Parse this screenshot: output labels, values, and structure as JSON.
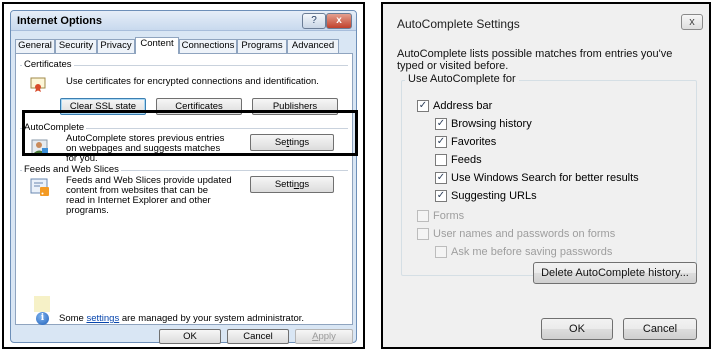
{
  "left_dialog": {
    "title": "Internet Options",
    "help_glyph": "?",
    "close_glyph": "x",
    "tabs": [
      "General",
      "Security",
      "Privacy",
      "Content",
      "Connections",
      "Programs",
      "Advanced"
    ],
    "active_tab": "Content",
    "certificates": {
      "label": "Certificates",
      "description": "Use certificates for encrypted connections and identification.",
      "clear_ssl_pre": "Clear ",
      "clear_ssl_u": "S",
      "clear_ssl_post": "SL state",
      "certificates_u": "C",
      "certificates_post": "ertificates",
      "publishers_pre": "Pu",
      "publishers_u": "b",
      "publishers_post": "lishers"
    },
    "autocomplete": {
      "label": "AutoComplete",
      "description_lines": [
        "AutoComplete stores previous entries",
        "on webpages and suggests matches",
        "for you."
      ],
      "settings_pre": "Se",
      "settings_u": "t",
      "settings_post": "tings"
    },
    "feeds": {
      "label": "Feeds and Web Slices",
      "description_lines": [
        "Feeds and Web Slices provide updated",
        "content from websites that can be",
        "read in Internet Explorer and other",
        "programs."
      ],
      "settings_pre": "Setti",
      "settings_u": "n",
      "settings_post": "gs"
    },
    "admin_note_pre": "Some ",
    "admin_note_link": "settings",
    "admin_note_post": " are managed by your system administrator.",
    "buttons": {
      "ok": "OK",
      "cancel": "Cancel",
      "apply_u": "A",
      "apply_post": "pply"
    }
  },
  "right_dialog": {
    "title": "AutoComplete Settings",
    "close_glyph": "x",
    "intro_lines": [
      "AutoComplete lists possible matches from entries you've",
      "typed or visited before."
    ],
    "group_label": "Use AutoComplete for",
    "options": [
      {
        "label": "Address bar",
        "checked": true,
        "enabled": true,
        "indent": 0
      },
      {
        "label": "Browsing history",
        "checked": true,
        "enabled": true,
        "indent": 1
      },
      {
        "label": "Favorites",
        "checked": true,
        "enabled": true,
        "indent": 1
      },
      {
        "label": "Feeds",
        "checked": false,
        "enabled": true,
        "indent": 1
      },
      {
        "label": "Use Windows Search for better results",
        "checked": true,
        "enabled": true,
        "indent": 1
      },
      {
        "label": "Suggesting URLs",
        "checked": true,
        "enabled": true,
        "indent": 1
      },
      {
        "label": "Forms",
        "checked": false,
        "enabled": false,
        "indent": 0
      },
      {
        "label": "User names and passwords on forms",
        "checked": false,
        "enabled": false,
        "indent": 0
      },
      {
        "label": "Ask me before saving passwords",
        "checked": false,
        "enabled": false,
        "indent": 1
      }
    ],
    "delete_history_label": "Delete AutoComplete history...",
    "ok_label": "OK",
    "cancel_label": "Cancel",
    "check_glyph": "✓"
  }
}
